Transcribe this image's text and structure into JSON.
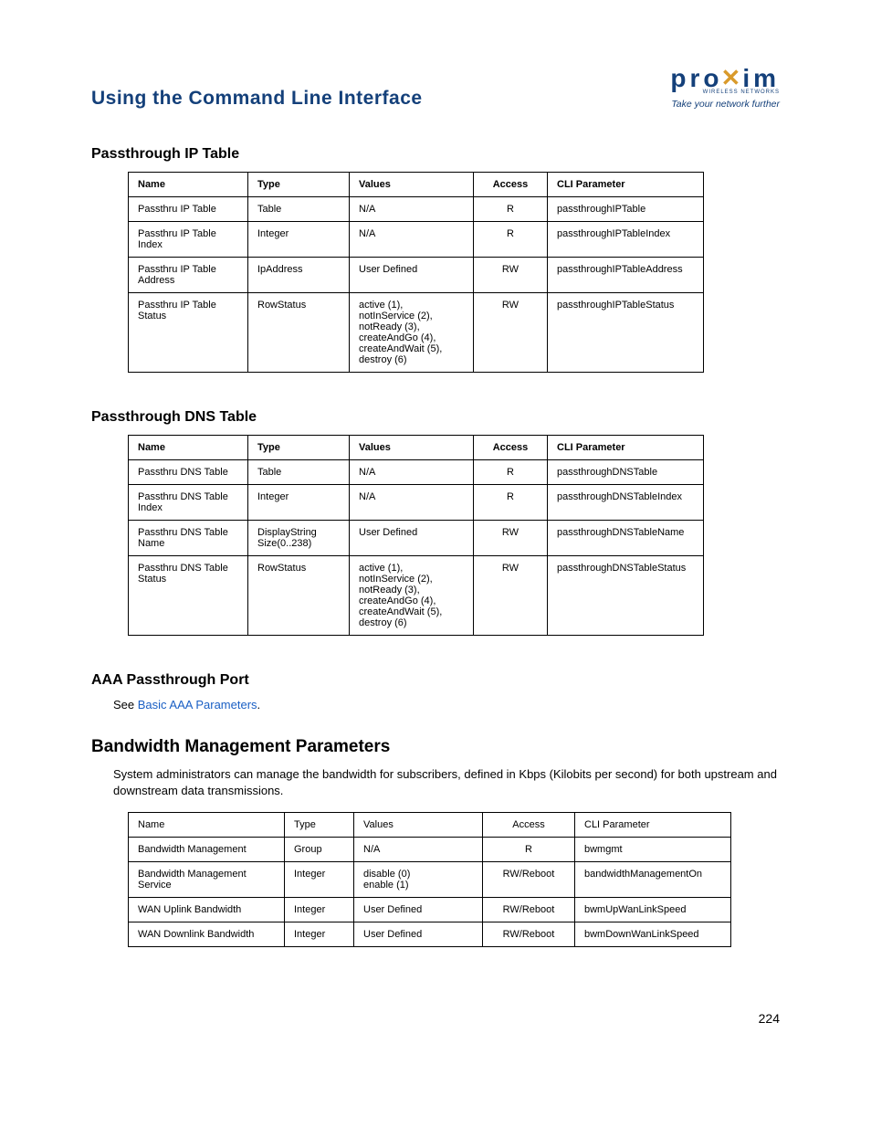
{
  "header": {
    "title": "Using the Command Line Interface",
    "logo_main_1": "pro",
    "logo_main_x": "✕",
    "logo_main_2": "im",
    "logo_sub": "WIRELESS NETWORKS",
    "logo_tag": "Take your network further"
  },
  "sections": {
    "s1_title": "Passthrough IP Table",
    "s2_title": "Passthrough DNS Table",
    "s3_title": "AAA Passthrough Port",
    "s3_see": "See ",
    "s3_link": "Basic AAA Parameters",
    "s3_dot": ".",
    "s4_title": "Bandwidth Management Parameters",
    "s4_body": "System administrators can manage the bandwidth for subscribers, defined in Kbps (Kilobits per second) for both upstream and downstream data transmissions."
  },
  "columns": {
    "name": "Name",
    "type": "Type",
    "values": "Values",
    "access": "Access",
    "cli": "CLI Parameter"
  },
  "t1": {
    "r1": {
      "name": "Passthru IP Table",
      "type": "Table",
      "values": "N/A",
      "access": "R",
      "cli": "passthroughIPTable"
    },
    "r2": {
      "name": "Passthru IP Table Index",
      "type": "Integer",
      "values": "N/A",
      "access": "R",
      "cli": "passthroughIPTableIndex"
    },
    "r3": {
      "name": "Passthru IP Table Address",
      "type": "IpAddress",
      "values": "User Defined",
      "access": "RW",
      "cli": "passthroughIPTableAddress"
    },
    "r4": {
      "name": "Passthru IP Table Status",
      "type": "RowStatus",
      "values": "active (1),\nnotInService (2),\nnotReady (3),\ncreateAndGo (4),\ncreateAndWait (5),\ndestroy (6)",
      "access": "RW",
      "cli": "passthroughIPTableStatus"
    }
  },
  "t2": {
    "r1": {
      "name": "Passthru DNS Table",
      "type": "Table",
      "values": "N/A",
      "access": "R",
      "cli": "passthroughDNSTable"
    },
    "r2": {
      "name": "Passthru DNS Table Index",
      "type": "Integer",
      "values": "N/A",
      "access": "R",
      "cli": "passthroughDNSTableIndex"
    },
    "r3": {
      "name": "Passthru DNS Table Name",
      "type": "DisplayString Size(0..238)",
      "values": "User Defined",
      "access": "RW",
      "cli": "passthroughDNSTableName"
    },
    "r4": {
      "name": "Passthru DNS Table Status",
      "type": "RowStatus",
      "values": "active (1),\nnotInService (2),\nnotReady (3),\ncreateAndGo (4),\ncreateAndWait (5),\ndestroy (6)",
      "access": "RW",
      "cli": "passthroughDNSTableStatus"
    }
  },
  "t3": {
    "r1": {
      "name": "Bandwidth Management",
      "type": "Group",
      "values": "N/A",
      "access": "R",
      "cli": "bwmgmt"
    },
    "r2": {
      "name": "Bandwidth Management Service",
      "type": "Integer",
      "values": "disable (0)\nenable (1)",
      "access": "RW/Reboot",
      "cli": "bandwidthManagementOn"
    },
    "r3": {
      "name": "WAN Uplink Bandwidth",
      "type": "Integer",
      "values": "User Defined",
      "access": "RW/Reboot",
      "cli": "bwmUpWanLinkSpeed"
    },
    "r4": {
      "name": "WAN Downlink Bandwidth",
      "type": "Integer",
      "values": "User Defined",
      "access": "RW/Reboot",
      "cli": "bwmDownWanLinkSpeed"
    }
  },
  "page_number": "224"
}
